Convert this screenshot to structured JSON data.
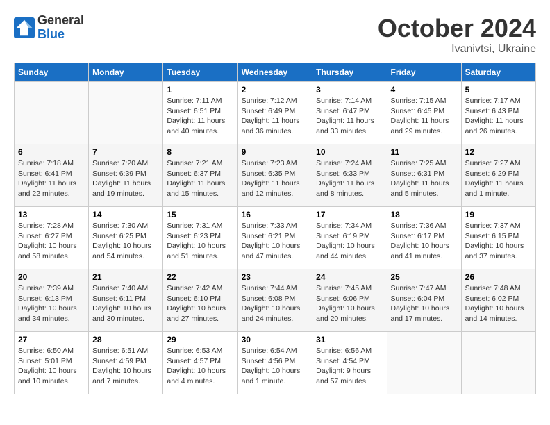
{
  "logo": {
    "general": "General",
    "blue": "Blue"
  },
  "title": "October 2024",
  "location": "Ivanivtsi, Ukraine",
  "days_of_week": [
    "Sunday",
    "Monday",
    "Tuesday",
    "Wednesday",
    "Thursday",
    "Friday",
    "Saturday"
  ],
  "weeks": [
    [
      null,
      null,
      {
        "day": 1,
        "sunrise": "Sunrise: 7:11 AM",
        "sunset": "Sunset: 6:51 PM",
        "daylight": "Daylight: 11 hours and 40 minutes."
      },
      {
        "day": 2,
        "sunrise": "Sunrise: 7:12 AM",
        "sunset": "Sunset: 6:49 PM",
        "daylight": "Daylight: 11 hours and 36 minutes."
      },
      {
        "day": 3,
        "sunrise": "Sunrise: 7:14 AM",
        "sunset": "Sunset: 6:47 PM",
        "daylight": "Daylight: 11 hours and 33 minutes."
      },
      {
        "day": 4,
        "sunrise": "Sunrise: 7:15 AM",
        "sunset": "Sunset: 6:45 PM",
        "daylight": "Daylight: 11 hours and 29 minutes."
      },
      {
        "day": 5,
        "sunrise": "Sunrise: 7:17 AM",
        "sunset": "Sunset: 6:43 PM",
        "daylight": "Daylight: 11 hours and 26 minutes."
      }
    ],
    [
      {
        "day": 6,
        "sunrise": "Sunrise: 7:18 AM",
        "sunset": "Sunset: 6:41 PM",
        "daylight": "Daylight: 11 hours and 22 minutes."
      },
      {
        "day": 7,
        "sunrise": "Sunrise: 7:20 AM",
        "sunset": "Sunset: 6:39 PM",
        "daylight": "Daylight: 11 hours and 19 minutes."
      },
      {
        "day": 8,
        "sunrise": "Sunrise: 7:21 AM",
        "sunset": "Sunset: 6:37 PM",
        "daylight": "Daylight: 11 hours and 15 minutes."
      },
      {
        "day": 9,
        "sunrise": "Sunrise: 7:23 AM",
        "sunset": "Sunset: 6:35 PM",
        "daylight": "Daylight: 11 hours and 12 minutes."
      },
      {
        "day": 10,
        "sunrise": "Sunrise: 7:24 AM",
        "sunset": "Sunset: 6:33 PM",
        "daylight": "Daylight: 11 hours and 8 minutes."
      },
      {
        "day": 11,
        "sunrise": "Sunrise: 7:25 AM",
        "sunset": "Sunset: 6:31 PM",
        "daylight": "Daylight: 11 hours and 5 minutes."
      },
      {
        "day": 12,
        "sunrise": "Sunrise: 7:27 AM",
        "sunset": "Sunset: 6:29 PM",
        "daylight": "Daylight: 11 hours and 1 minute."
      }
    ],
    [
      {
        "day": 13,
        "sunrise": "Sunrise: 7:28 AM",
        "sunset": "Sunset: 6:27 PM",
        "daylight": "Daylight: 10 hours and 58 minutes."
      },
      {
        "day": 14,
        "sunrise": "Sunrise: 7:30 AM",
        "sunset": "Sunset: 6:25 PM",
        "daylight": "Daylight: 10 hours and 54 minutes."
      },
      {
        "day": 15,
        "sunrise": "Sunrise: 7:31 AM",
        "sunset": "Sunset: 6:23 PM",
        "daylight": "Daylight: 10 hours and 51 minutes."
      },
      {
        "day": 16,
        "sunrise": "Sunrise: 7:33 AM",
        "sunset": "Sunset: 6:21 PM",
        "daylight": "Daylight: 10 hours and 47 minutes."
      },
      {
        "day": 17,
        "sunrise": "Sunrise: 7:34 AM",
        "sunset": "Sunset: 6:19 PM",
        "daylight": "Daylight: 10 hours and 44 minutes."
      },
      {
        "day": 18,
        "sunrise": "Sunrise: 7:36 AM",
        "sunset": "Sunset: 6:17 PM",
        "daylight": "Daylight: 10 hours and 41 minutes."
      },
      {
        "day": 19,
        "sunrise": "Sunrise: 7:37 AM",
        "sunset": "Sunset: 6:15 PM",
        "daylight": "Daylight: 10 hours and 37 minutes."
      }
    ],
    [
      {
        "day": 20,
        "sunrise": "Sunrise: 7:39 AM",
        "sunset": "Sunset: 6:13 PM",
        "daylight": "Daylight: 10 hours and 34 minutes."
      },
      {
        "day": 21,
        "sunrise": "Sunrise: 7:40 AM",
        "sunset": "Sunset: 6:11 PM",
        "daylight": "Daylight: 10 hours and 30 minutes."
      },
      {
        "day": 22,
        "sunrise": "Sunrise: 7:42 AM",
        "sunset": "Sunset: 6:10 PM",
        "daylight": "Daylight: 10 hours and 27 minutes."
      },
      {
        "day": 23,
        "sunrise": "Sunrise: 7:44 AM",
        "sunset": "Sunset: 6:08 PM",
        "daylight": "Daylight: 10 hours and 24 minutes."
      },
      {
        "day": 24,
        "sunrise": "Sunrise: 7:45 AM",
        "sunset": "Sunset: 6:06 PM",
        "daylight": "Daylight: 10 hours and 20 minutes."
      },
      {
        "day": 25,
        "sunrise": "Sunrise: 7:47 AM",
        "sunset": "Sunset: 6:04 PM",
        "daylight": "Daylight: 10 hours and 17 minutes."
      },
      {
        "day": 26,
        "sunrise": "Sunrise: 7:48 AM",
        "sunset": "Sunset: 6:02 PM",
        "daylight": "Daylight: 10 hours and 14 minutes."
      }
    ],
    [
      {
        "day": 27,
        "sunrise": "Sunrise: 6:50 AM",
        "sunset": "Sunset: 5:01 PM",
        "daylight": "Daylight: 10 hours and 10 minutes."
      },
      {
        "day": 28,
        "sunrise": "Sunrise: 6:51 AM",
        "sunset": "Sunset: 4:59 PM",
        "daylight": "Daylight: 10 hours and 7 minutes."
      },
      {
        "day": 29,
        "sunrise": "Sunrise: 6:53 AM",
        "sunset": "Sunset: 4:57 PM",
        "daylight": "Daylight: 10 hours and 4 minutes."
      },
      {
        "day": 30,
        "sunrise": "Sunrise: 6:54 AM",
        "sunset": "Sunset: 4:56 PM",
        "daylight": "Daylight: 10 hours and 1 minute."
      },
      {
        "day": 31,
        "sunrise": "Sunrise: 6:56 AM",
        "sunset": "Sunset: 4:54 PM",
        "daylight": "Daylight: 9 hours and 57 minutes."
      },
      null,
      null
    ]
  ]
}
